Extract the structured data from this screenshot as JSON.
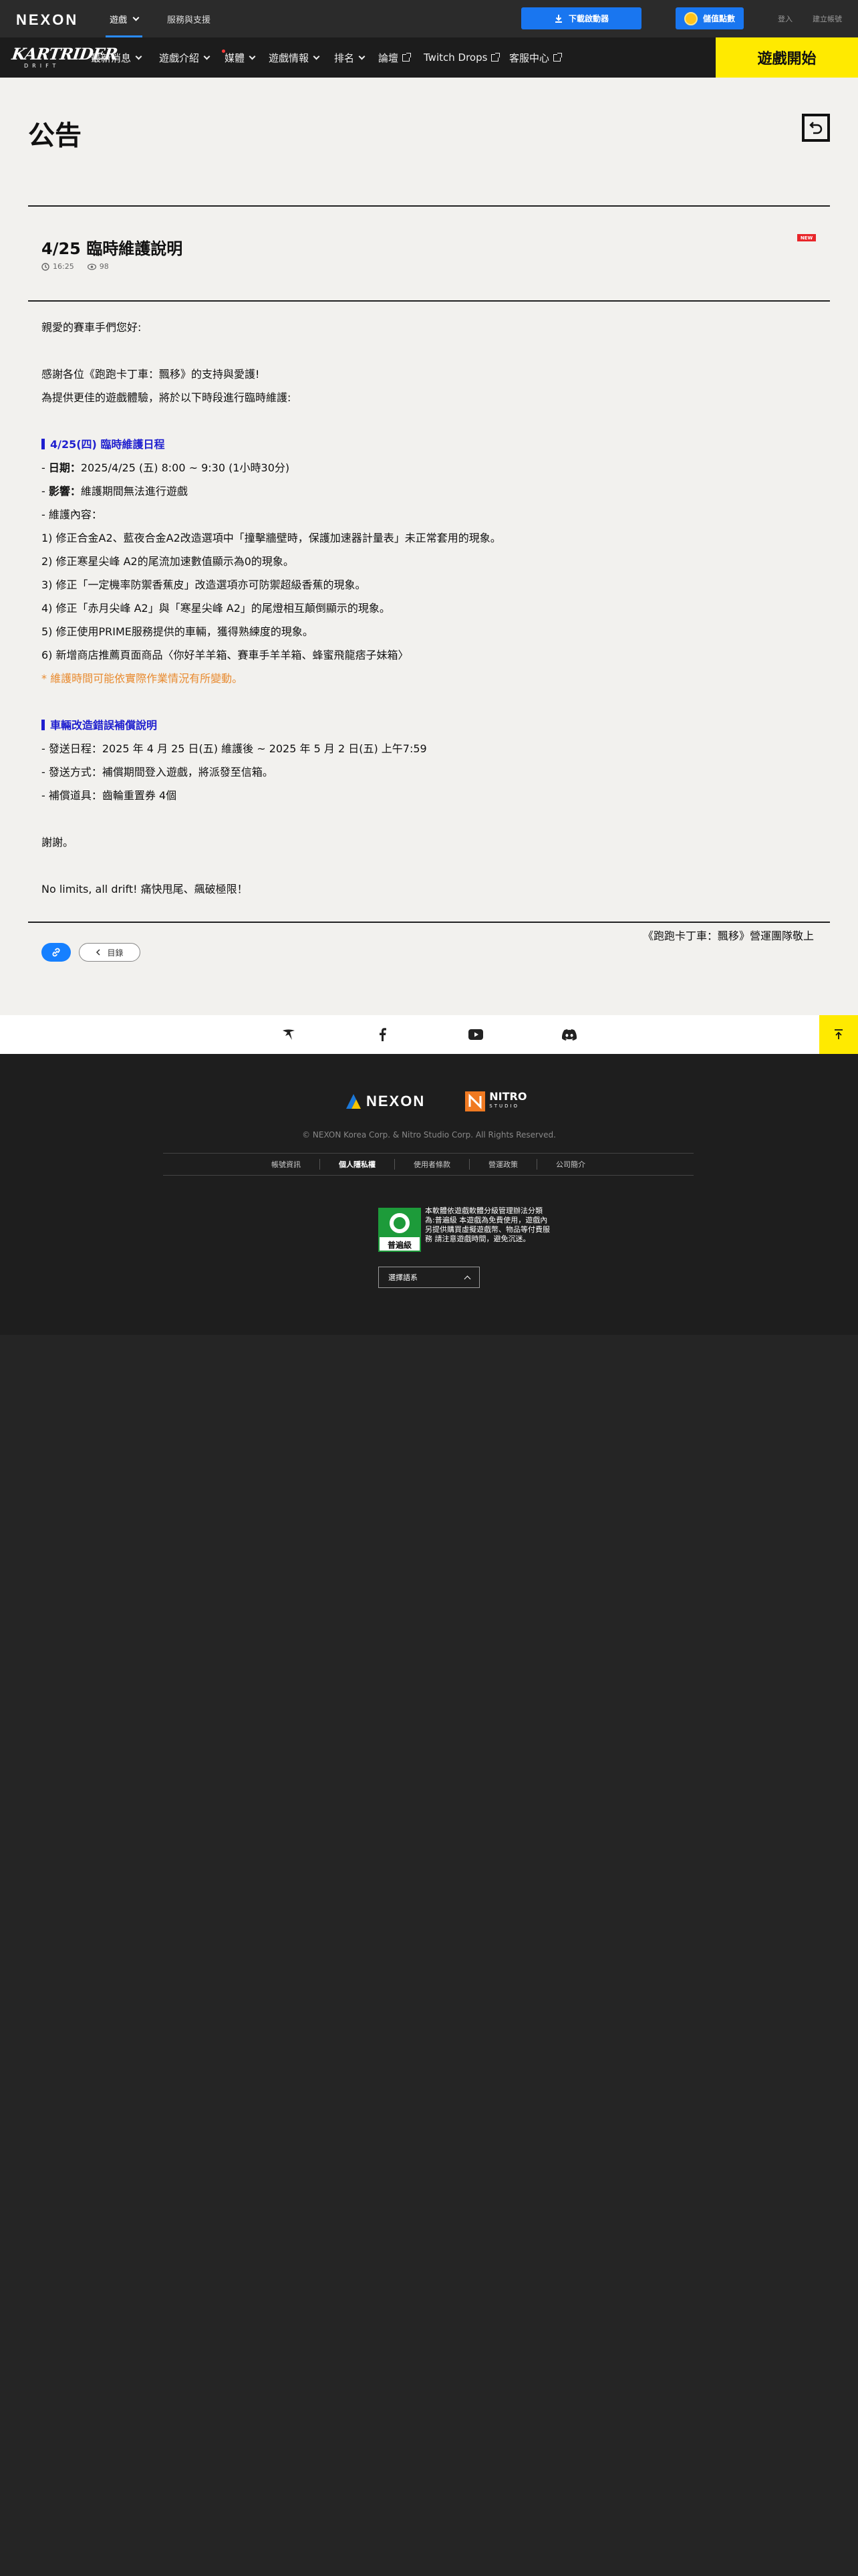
{
  "topbar": {
    "logo": "NEXON",
    "tabs": [
      "遊戲",
      "服務與支援"
    ],
    "download_label": "下載啟動器",
    "points_label": "儲值點數",
    "login_label": "登入",
    "signup_label": "建立帳號"
  },
  "gamenav": {
    "logo_main": "KARTRIDER",
    "logo_sub": "DRIFT",
    "items": [
      "最新消息",
      "遊戲介紹",
      "媒體",
      "遊戲情報",
      "排名",
      "論壇",
      "Twitch Drops",
      "客服中心"
    ],
    "start_label": "遊戲開始"
  },
  "page": {
    "title": "公告"
  },
  "post": {
    "title": "4/25 臨時維護說明",
    "time": "16:25",
    "views": "98",
    "badge": "NEW",
    "lines": [
      "親愛的賽車手們您好:",
      "",
      "感謝各位《跑跑卡丁車：飄移》的支持與愛護!",
      "為提供更佳的遊戲體驗，將於以下時段進行臨時維護:",
      "",
      "4/25(四) 臨時維護日程",
      "- 日期：2025/4/25 (五) 8:00 ~ 9:30 (1小時30分)",
      "- 影響：維護期間無法進行遊戲",
      "- 維護內容：",
      "1) 修正合金A2、藍夜合金A2改造選項中「撞擊牆壁時，保護加速器計量表」未正常套用的現象。",
      "2) 修正寒星尖峰 A2的尾流加速數值顯示為0的現象。",
      "3) 修正「一定機率防禦香蕉皮」改造選項亦可防禦超級香蕉的現象。",
      "4) 修正「赤月尖峰 A2」與「寒星尖峰 A2」的尾燈相互顛倒顯示的現象。",
      "5) 修正使用PRIME服務提供的車輛，獲得熟練度的現象。",
      "6) 新增商店推薦頁面商品〈你好羊羊箱、賽車手羊羊箱、蜂蜜飛龍痞子妹箱〉",
      "* 維護時間可能依實際作業情況有所變動。",
      "",
      "車輛改造錯誤補償說明",
      "- 發送日程：2025 年 4 月 25 日(五) 維護後 ~ 2025 年 5 月 2 日(五) 上午7:59",
      "- 發送方式：補償期間登入遊戲，將派發至信箱。",
      "- 補償道具：齒輪重置券 4個",
      "",
      "謝謝。",
      "",
      "No limits, all drift! 痛快甩尾、飆破極限！",
      "",
      "《跑跑卡丁車：飄移》營運團隊敬上"
    ],
    "list_label": "目錄"
  },
  "footer": {
    "nexon_logo": "NEXON",
    "nitro_logo": "NITRO",
    "nitro_sub": "STUDIO",
    "copyright": "© NEXON Korea Corp. & Nitro Studio Corp. All Rights Reserved.",
    "links": [
      "帳號資訊",
      "個人隱私權",
      "使用者條款",
      "營運政策",
      "公司簡介"
    ],
    "rating_label": "普遍級",
    "rating_text": "本軟體依遊戲軟體分級管理辦法分類為:普遍級 本遊戲為免費使用，遊戲內另提供購買虛擬遊戲幣、物品等付費服務 請注意遊戲時間，避免沉迷。",
    "language_label": "選擇語系"
  },
  "colors": {
    "accent_blue": "#1976f0",
    "start_yellow": "#ffea00",
    "heading_blue": "#1f1fcf",
    "notice_orange": "#e88a2f"
  }
}
